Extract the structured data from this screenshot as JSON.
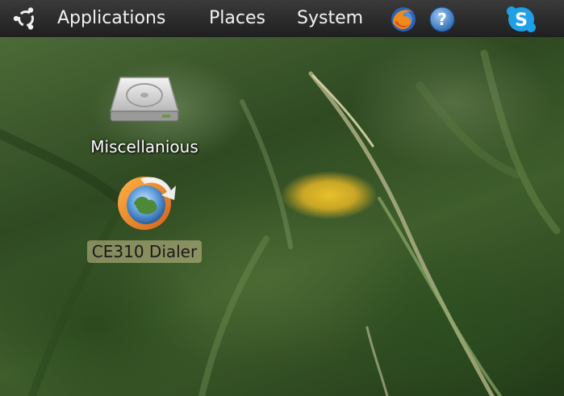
{
  "panel": {
    "menus": [
      "Applications",
      "Places",
      "System"
    ],
    "launchers": {
      "browser": "firefox-icon",
      "help": "help-icon",
      "skype": "skype-icon"
    },
    "logo": "ubuntu-logo-icon"
  },
  "desktop": {
    "icons": [
      {
        "label": "Miscellanious",
        "icon": "hard-drive-icon",
        "selected": false
      },
      {
        "label": "CE310 Dialer",
        "icon": "dialer-globe-icon",
        "selected": true
      }
    ]
  },
  "colors": {
    "panel_bg": "#2a2a2a",
    "panel_text": "#f2f2f2",
    "selection_bg": "#c8be8c"
  }
}
